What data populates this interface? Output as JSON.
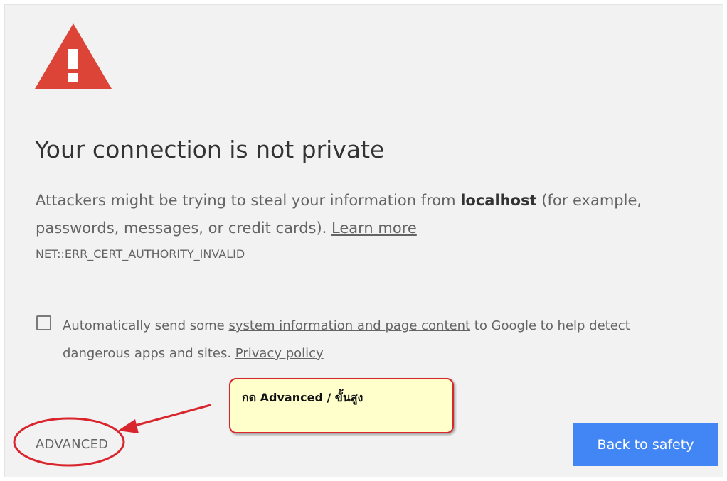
{
  "colors": {
    "page_background": "#f2f2f2",
    "warning_red": "#db4437",
    "primary_button": "#4285f4",
    "annotation_outline": "#d9262e",
    "annotation_fill": "#ffffcc"
  },
  "icon": "warning-triangle-icon",
  "heading": "Your connection is not private",
  "explanation": {
    "part1": "Attackers might be trying to steal your information from ",
    "host": "localhost",
    "part2": " (for example, passwords, messages, or credit cards). ",
    "learn_more": "Learn more"
  },
  "error_code": "NET::ERR_CERT_AUTHORITY_INVALID",
  "report": {
    "checked": false,
    "part1": "Automatically send some ",
    "link": "system information and page content",
    "part2": " to Google to help detect dangerous apps and sites. ",
    "privacy_link": "Privacy policy"
  },
  "buttons": {
    "advanced": "ADVANCED",
    "back_to_safety": "Back to safety"
  },
  "annotation": {
    "note": "กด Advanced / ขั้นสูง"
  }
}
